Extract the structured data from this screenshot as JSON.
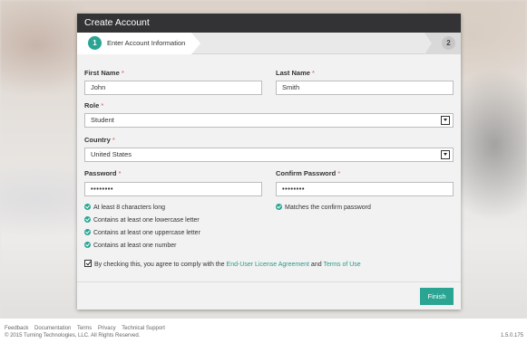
{
  "header": {
    "title": "Create Account"
  },
  "wizard": {
    "step1_num": "1",
    "step1_label": "Enter Account Information",
    "step2_num": "2"
  },
  "form": {
    "first_name": {
      "label": "First Name",
      "required": "*",
      "value": "John"
    },
    "last_name": {
      "label": "Last Name",
      "required": "*",
      "value": "Smith"
    },
    "role": {
      "label": "Role",
      "required": "*",
      "value": "Student"
    },
    "country": {
      "label": "Country",
      "required": "*",
      "value": "United States"
    },
    "password": {
      "label": "Password",
      "required": "*",
      "value": "••••••••"
    },
    "confirm_password": {
      "label": "Confirm Password",
      "required": "*",
      "value": "••••••••"
    }
  },
  "password_rules": [
    "At least 8 characters long",
    "Contains at least one lowercase letter",
    "Contains at least one uppercase letter",
    "Contains at least one number"
  ],
  "confirm_rule": "Matches the confirm password",
  "agreement": {
    "text_before": "By checking this, you agree to comply with the",
    "eula_link": "End-User License Agreement",
    "and": "and",
    "terms_link": "Terms of Use",
    "checked": true
  },
  "actions": {
    "finish_label": "Finish"
  },
  "footer": {
    "links": [
      "Feedback",
      "Documentation",
      "Terms",
      "Privacy",
      "Technical Support"
    ],
    "copyright": "© 2015 Turning Technologies, LLC. All Rights Reserved.",
    "version": "1.5.0.175"
  },
  "colors": {
    "accent": "#2aa593",
    "header": "#333335",
    "required": "#d9534f"
  },
  "icons": {
    "rule_check": "check-circle-icon",
    "select_arrow": "chevron-down-icon"
  }
}
